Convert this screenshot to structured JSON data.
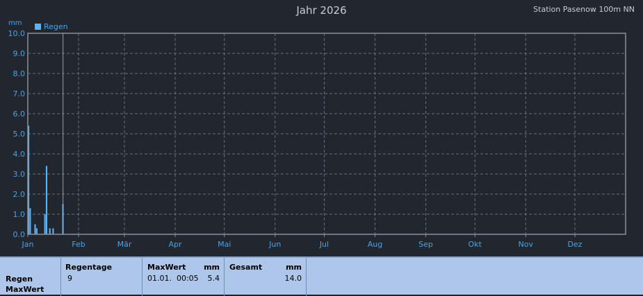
{
  "title": "Jahr 2026",
  "station": "Station Pasenow 100m NN",
  "colors": {
    "bg": "#22262e",
    "series": "#5fb0ee",
    "axis_text": "#4aa3e6",
    "panel": "#aec6ea"
  },
  "chart_data": {
    "type": "bar",
    "title": "Jahr 2026",
    "ylabel": "mm",
    "ylim": [
      0,
      10
    ],
    "yticks": [
      "0.0",
      "1.0",
      "2.0",
      "3.0",
      "4.0",
      "5.0",
      "6.0",
      "7.0",
      "8.0",
      "9.0",
      "10.0"
    ],
    "xticks": [
      "Jan",
      "Feb",
      "Mär",
      "Apr",
      "Mai",
      "Jun",
      "Jul",
      "Aug",
      "Sep",
      "Okt",
      "Nov",
      "Dez"
    ],
    "grid": true,
    "legend": "top-left",
    "series": [
      {
        "name": "Regen",
        "x": [
          1,
          2,
          5,
          6,
          11,
          12,
          14,
          16,
          22
        ],
        "values": [
          5.4,
          1.3,
          0.5,
          0.3,
          1.0,
          3.4,
          0.3,
          0.3,
          1.5
        ]
      }
    ],
    "marker_day": 22
  },
  "stats": {
    "row_label_1": "Regen",
    "row_label_2": "MaxWert",
    "regentage_label": "Regentage",
    "regentage_value": "9",
    "maxwert_label": "MaxWert",
    "maxwert_unit": "mm",
    "maxwert_time": "01.01.  00:05",
    "maxwert_value": "5.4",
    "gesamt_label": "Gesamt",
    "gesamt_unit": "mm",
    "gesamt_value": "14.0"
  }
}
